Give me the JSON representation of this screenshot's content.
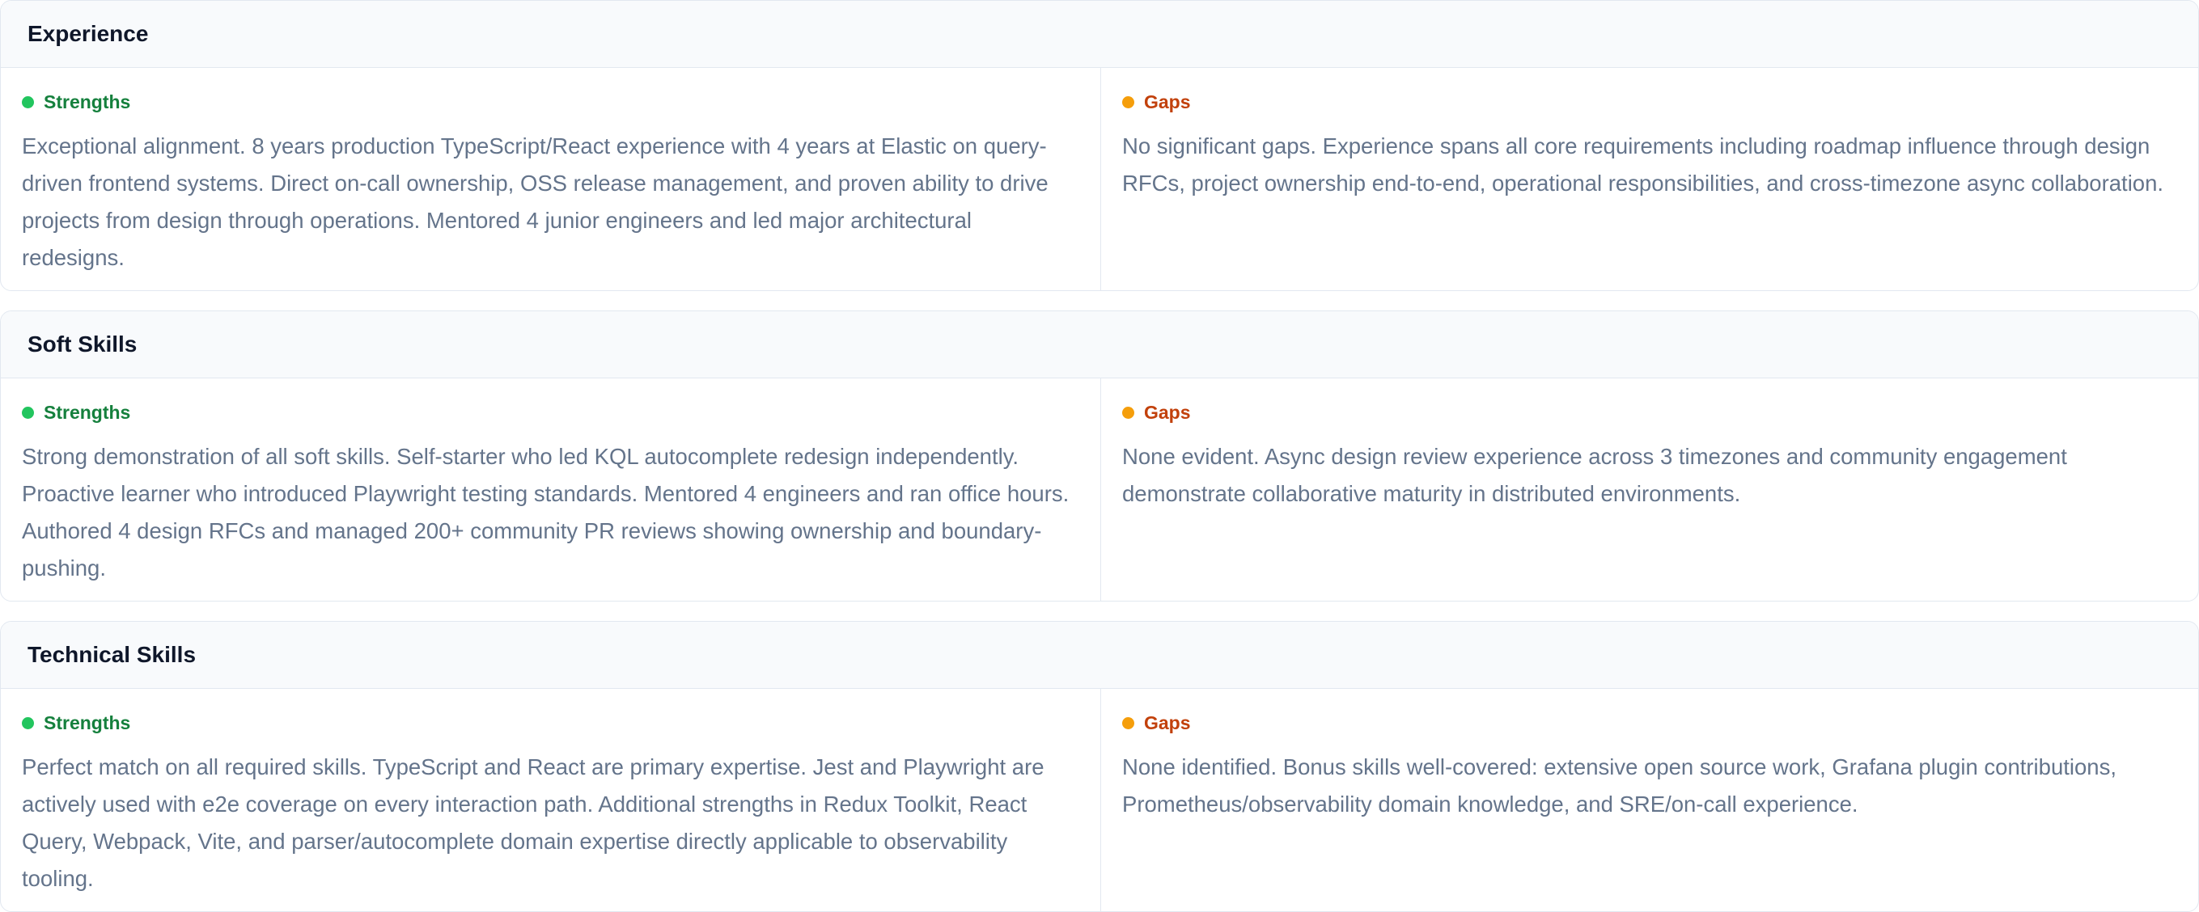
{
  "colors": {
    "strength_dot": "#22c55e",
    "strength_text": "#15803d",
    "gap_dot": "#f59e0b",
    "gap_text": "#c2410c"
  },
  "sections": [
    {
      "title": "Experience",
      "strengths_label": "Strengths",
      "strengths_text": "Exceptional alignment. 8 years production TypeScript/React experience with 4 years at Elastic on query-driven frontend systems. Direct on-call ownership, OSS release management, and proven ability to drive projects from design through operations. Mentored 4 junior engineers and led major architectural redesigns.",
      "gaps_label": "Gaps",
      "gaps_text": "No significant gaps. Experience spans all core requirements including roadmap influence through design RFCs, project ownership end-to-end, operational responsibilities, and cross-timezone async collaboration."
    },
    {
      "title": "Soft Skills",
      "strengths_label": "Strengths",
      "strengths_text": "Strong demonstration of all soft skills. Self-starter who led KQL autocomplete redesign independently. Proactive learner who introduced Playwright testing standards. Mentored 4 engineers and ran office hours. Authored 4 design RFCs and managed 200+ community PR reviews showing ownership and boundary-pushing.",
      "gaps_label": "Gaps",
      "gaps_text": "None evident. Async design review experience across 3 timezones and community engagement demonstrate collaborative maturity in distributed environments."
    },
    {
      "title": "Technical Skills",
      "strengths_label": "Strengths",
      "strengths_text": "Perfect match on all required skills. TypeScript and React are primary expertise. Jest and Playwright are actively used with e2e coverage on every interaction path. Additional strengths in Redux Toolkit, React Query, Webpack, Vite, and parser/autocomplete domain expertise directly applicable to observability tooling.",
      "gaps_label": "Gaps",
      "gaps_text": "None identified. Bonus skills well-covered: extensive open source work, Grafana plugin contributions, Prometheus/observability domain knowledge, and SRE/on-call experience."
    }
  ]
}
